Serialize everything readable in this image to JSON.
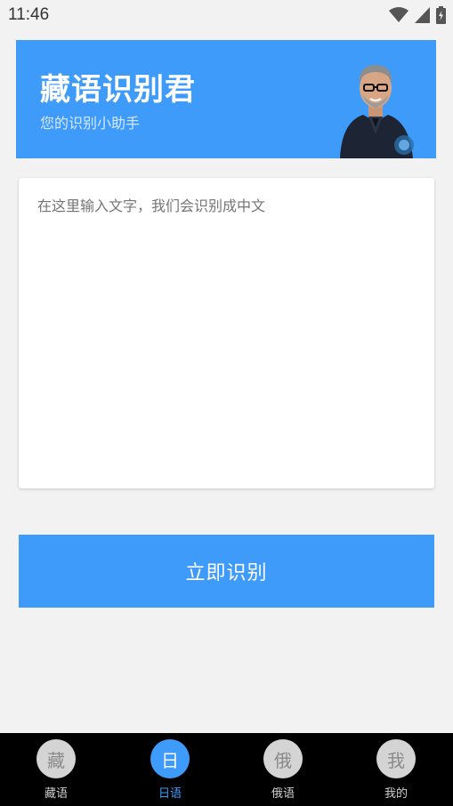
{
  "status_bar": {
    "time": "11:46",
    "icons": [
      "wifi-icon",
      "signal-icon",
      "battery-icon"
    ]
  },
  "banner": {
    "title": "藏语识别君",
    "subtitle": "您的识别小助手",
    "image": "robot-man-avatar"
  },
  "input": {
    "placeholder": "在这里输入文字，我们会识别成中文",
    "value": ""
  },
  "action_button": {
    "label": "立即识别"
  },
  "bottom_nav": {
    "items": [
      {
        "icon_char": "藏",
        "label": "藏语",
        "active": false
      },
      {
        "icon_char": "日",
        "label": "日语",
        "active": true
      },
      {
        "icon_char": "俄",
        "label": "俄语",
        "active": false
      },
      {
        "icon_char": "我",
        "label": "我的",
        "active": false
      }
    ]
  },
  "colors": {
    "accent": "#3f9bfa",
    "background": "#f2f2f2",
    "nav_bg": "#000000"
  }
}
